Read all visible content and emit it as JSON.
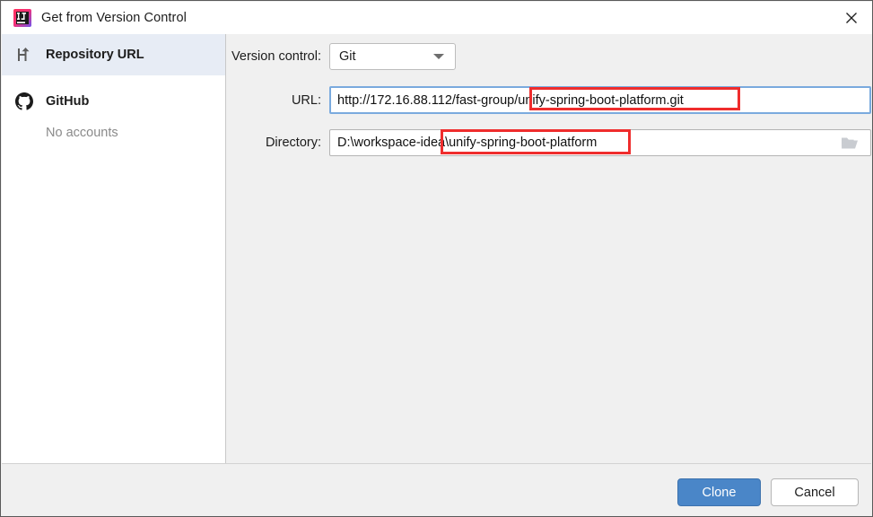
{
  "window": {
    "title": "Get from Version Control",
    "app_icon": "intellij-idea-icon",
    "close_label": "✕"
  },
  "sidebar": {
    "items": [
      {
        "id": "repository-url",
        "label": "Repository URL",
        "icon": "branch-icon",
        "selected": true
      },
      {
        "id": "github",
        "label": "GitHub",
        "icon": "github-icon",
        "selected": false,
        "sub_label": "No accounts"
      }
    ]
  },
  "form": {
    "version_control": {
      "label": "Version control:",
      "value": "Git",
      "options": [
        "Git"
      ]
    },
    "url": {
      "label": "URL:",
      "value": "http://172.16.88.112/fast-group/unify-spring-boot-platform.git",
      "placeholder": ""
    },
    "directory": {
      "label": "Directory:",
      "value": "D:\\workspace-idea\\unify-spring-boot-platform",
      "placeholder": "",
      "browse_icon": "folder-icon"
    }
  },
  "annotations": [
    {
      "id": "url-highlight",
      "target": "unify-spring-boot-platform.git",
      "color": "#ef2d2d"
    },
    {
      "id": "directory-highlight",
      "target": "\\unify-spring-boot-platform",
      "color": "#ef2d2d"
    }
  ],
  "footer": {
    "primary_label": "Clone",
    "secondary_label": "Cancel",
    "primary_color": "#4a86c8"
  }
}
